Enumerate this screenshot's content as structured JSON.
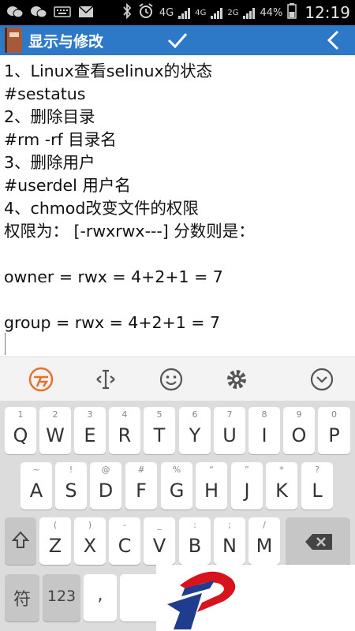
{
  "status_bar": {
    "net1": "4G",
    "net2": "4G",
    "net3": "2G",
    "battery": "44%",
    "time": "12:19",
    "icons": [
      "wechat-icon",
      "wechat-icon",
      "keyboard-icon",
      "mail-icon",
      "bluetooth-icon",
      "alarm-icon"
    ]
  },
  "action_bar": {
    "title": "显示与修改",
    "confirm_icon": "check-icon",
    "back_icon": "chevron-left-icon",
    "color": "#2e78c8"
  },
  "editor": {
    "lines": [
      "1、Linux查看selinux的状态",
      "#sestatus",
      "2、删除目录",
      "#rm -rf 目录名",
      "3、删除用户",
      "#userdel 用户名",
      "4、chmod改变文件的权限",
      "权限为： [-rwxrwx---] 分数则是：",
      "",
      "owner = rwx = 4+2+1 = 7",
      "",
      "group = rwx = 4+2+1 = 7"
    ]
  },
  "keyboard_toolbar": {
    "icons": [
      "swype-icon",
      "cursor-icon",
      "emoji-icon",
      "settings-icon",
      "hide-keyboard-icon"
    ],
    "accent": "#e8702a"
  },
  "keyboard": {
    "row1": [
      {
        "hint": "1",
        "key": "Q"
      },
      {
        "hint": "2",
        "key": "W"
      },
      {
        "hint": "3",
        "key": "E"
      },
      {
        "hint": "4",
        "key": "R"
      },
      {
        "hint": "5",
        "key": "T"
      },
      {
        "hint": "6",
        "key": "Y"
      },
      {
        "hint": "7",
        "key": "U"
      },
      {
        "hint": "8",
        "key": "I"
      },
      {
        "hint": "9",
        "key": "O"
      },
      {
        "hint": "0",
        "key": "P"
      }
    ],
    "row2": [
      {
        "hint": "~",
        "key": "A"
      },
      {
        "hint": "!",
        "key": "S"
      },
      {
        "hint": "@",
        "key": "D"
      },
      {
        "hint": "#",
        "key": "F"
      },
      {
        "hint": "%",
        "key": "G"
      },
      {
        "hint": "“",
        "key": "H"
      },
      {
        "hint": "”",
        "key": "J"
      },
      {
        "hint": "*",
        "key": "K"
      },
      {
        "hint": "?",
        "key": "L"
      }
    ],
    "row3": [
      {
        "hint": "(",
        "key": "Z"
      },
      {
        "hint": ")",
        "key": "X"
      },
      {
        "hint": "-",
        "key": "C"
      },
      {
        "hint": "_",
        "key": "V"
      },
      {
        "hint": ":",
        "key": "B"
      },
      {
        "hint": ";",
        "key": "N"
      },
      {
        "hint": "/",
        "key": "M"
      }
    ],
    "shift_icon": "shift-icon",
    "backspace_icon": "backspace-icon",
    "row4": {
      "symbols": "符",
      "numbers": "123",
      "comma": ","
    }
  }
}
